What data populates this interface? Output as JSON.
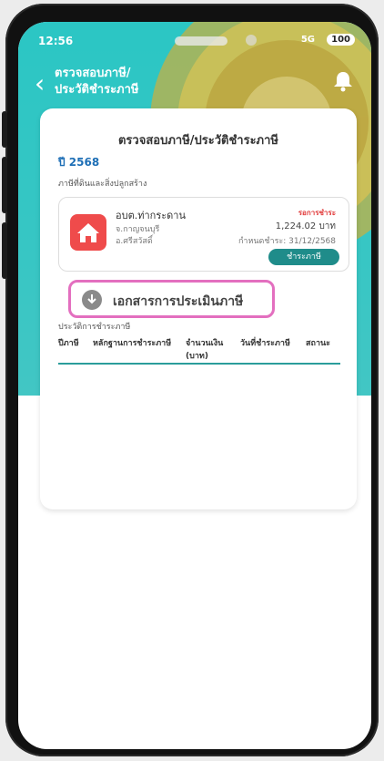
{
  "status": {
    "time": "12:56",
    "battery": "100",
    "signal": "5G"
  },
  "header": {
    "title_line1": "ตรวจสอบภาษี/",
    "title_line2": "ประวัติชำระภาษี"
  },
  "card": {
    "title": "ตรวจสอบภาษี/ประวัติชำระภาษี",
    "year": "ปี 2568",
    "section": "ภาษีที่ดินและสิ่งปลูกสร้าง"
  },
  "item": {
    "name": "อบต.ท่ากระดาน",
    "addr1": "จ.กาญจนบุรี",
    "addr2": "อ.ศรีสวัสดิ์",
    "pay_label": "รอการชำระ",
    "amount": "1,224.02 บาท",
    "due": "กำหนดชำระ: 31/12/2568",
    "pay_button": "ชำระภาษี"
  },
  "doc_button": "เอกสารการประเมินภาษี",
  "history": {
    "label": "ประวัติการชำระภาษี",
    "columns": [
      "ปีภาษี",
      "หลักฐานการชำระภาษี",
      "จำนวนเงิน (บาท)",
      "วันที่ชำระภาษี",
      "สถานะ"
    ]
  },
  "colors": {
    "header": "#2bc6c4",
    "accent": "#1f8c8a",
    "highlight": "#e36fbf",
    "year": "#1e6fb6"
  }
}
